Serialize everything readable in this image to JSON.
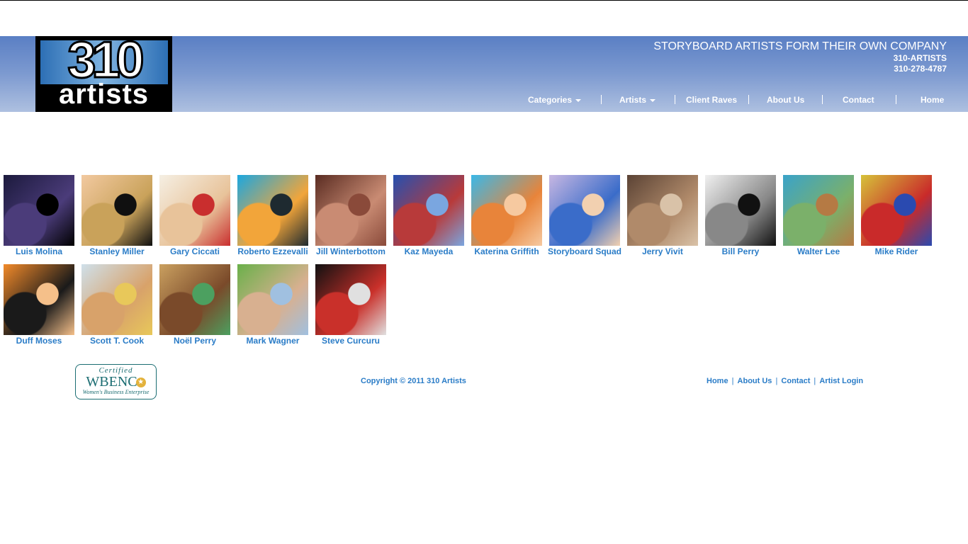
{
  "header": {
    "logo_number": "310",
    "logo_word": "artists",
    "headline": "STORYBOARD ARTISTS FORM THEIR OWN COMPANY",
    "company": "310-ARTISTS",
    "phone": "310-278-4787"
  },
  "nav": [
    {
      "label": "Categories",
      "dropdown": true
    },
    {
      "label": "Artists",
      "dropdown": true
    },
    {
      "label": "Client Raves",
      "dropdown": false
    },
    {
      "label": "About Us",
      "dropdown": false
    },
    {
      "label": "Contact",
      "dropdown": false
    },
    {
      "label": "Home",
      "dropdown": false
    }
  ],
  "artists": [
    {
      "name": "Luis Molina",
      "colors": [
        "#1c1a3d",
        "#4b3c7a",
        "#000000"
      ]
    },
    {
      "name": "Stanley Miller",
      "colors": [
        "#f2c9a0",
        "#c9a25a",
        "#101010"
      ]
    },
    {
      "name": "Gary Ciccati",
      "colors": [
        "#f5efe3",
        "#e8c39a",
        "#c92e2e"
      ]
    },
    {
      "name": "Roberto Ezzevalli",
      "colors": [
        "#1ba7e0",
        "#f2a53a",
        "#1e2a30"
      ]
    },
    {
      "name": "Jill Winterbottom",
      "colors": [
        "#5a2c22",
        "#c98b73",
        "#8a4a3a"
      ]
    },
    {
      "name": "Kaz Mayeda",
      "colors": [
        "#2550b0",
        "#b83a3a",
        "#7aa6e0"
      ]
    },
    {
      "name": "Katerina Griffith",
      "colors": [
        "#3ab8e8",
        "#e8843a",
        "#f6c9a0"
      ]
    },
    {
      "name": "Storyboard Squad",
      "colors": [
        "#c7b7e2",
        "#3a6cc9",
        "#f2d0b0"
      ]
    },
    {
      "name": "Jerry Vivit",
      "colors": [
        "#5b4335",
        "#b08a6a",
        "#d9c2a8"
      ]
    },
    {
      "name": "Bill Perry",
      "colors": [
        "#f0f0f0",
        "#888888",
        "#111111"
      ]
    },
    {
      "name": "Walter Lee",
      "colors": [
        "#3aa3c9",
        "#7bb06a",
        "#b57a44"
      ]
    },
    {
      "name": "Mike Rider",
      "colors": [
        "#d6c23a",
        "#c92a2a",
        "#2a4ab0"
      ]
    },
    {
      "name": "Duff Moses",
      "colors": [
        "#f28a2a",
        "#1a1a1a",
        "#f5c08a"
      ]
    },
    {
      "name": "Scott T. Cook",
      "colors": [
        "#cfe0ea",
        "#d8a26a",
        "#e8c85a"
      ]
    },
    {
      "name": "Noël Perry",
      "colors": [
        "#caa060",
        "#7a4a2a",
        "#4ca060"
      ]
    },
    {
      "name": "Mark Wagner",
      "colors": [
        "#6ab04a",
        "#d8b090",
        "#a0c0e0"
      ]
    },
    {
      "name": "Steve Curcuru",
      "colors": [
        "#111111",
        "#c9302a",
        "#e0e0e0"
      ]
    }
  ],
  "footer": {
    "badge_certified": "Certified",
    "badge_main": "WBENC",
    "badge_sub": "Women's Business Enterprise",
    "copyright": "Copyright © 2011 310 Artists",
    "links": [
      "Home",
      "About Us",
      "Contact",
      "Artist Login"
    ]
  }
}
